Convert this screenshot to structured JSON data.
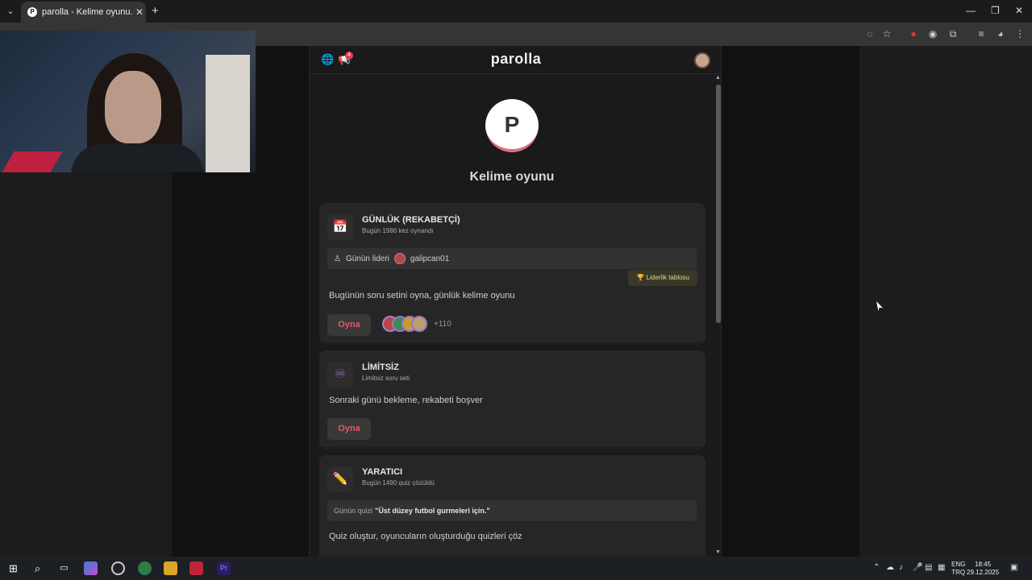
{
  "browser": {
    "tab_title": "parolla - Kelime oyunu. Günlük",
    "tab_favicon": "P",
    "close_tab": "✕",
    "new_tab": "+",
    "tab_list": "⌄",
    "window_controls": [
      "—",
      "❐",
      "✕"
    ]
  },
  "app": {
    "brand": "parolla",
    "notification_count": "4",
    "logo_letter": "P",
    "subtitle": "Kelime oyunu"
  },
  "cards": [
    {
      "icon": "📅",
      "title": "GÜNLÜK (REKABETÇİ)",
      "subtitle": "Bugün 1986 kez oynandı",
      "leader_label": "Günün lideri",
      "leader_name": "galipcan01",
      "leaderboard_label": "🏆 Liderlik tablosu",
      "description": "Bugünün soru setini oyna, günlük kelime oyunu",
      "play_label": "Oyna",
      "players_more": "+110"
    },
    {
      "icon": "♾",
      "title": "LİMİTSİZ",
      "subtitle": "Limitsiz soru seti",
      "description": "Sonraki günü bekleme, rekabeti boşver",
      "play_label": "Oyna"
    },
    {
      "icon": "✏️",
      "title": "YARATICI",
      "subtitle": "Bugün 1490 quiz çözüldü",
      "quiz_label": "Günün quizi",
      "quiz_name": "\"Üst düzey futbol gurmeleri için.\"",
      "description": "Quiz oluştur, oyuncuların oluşturduğu quizleri çöz"
    }
  ],
  "taskbar": {
    "lang_top": "ENG",
    "lang_bottom": "TRQ",
    "time": "18:45",
    "date": "29.12.2025"
  },
  "colors": {
    "accent": "#e25b6a",
    "card_bg": "#262626",
    "page_bg": "#1a1a1a"
  }
}
